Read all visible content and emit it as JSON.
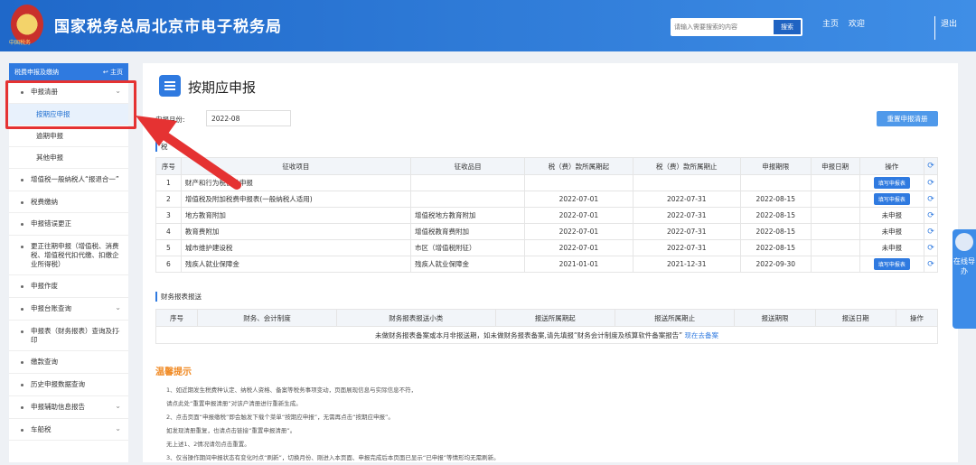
{
  "header": {
    "logo_sub": "中国税务",
    "title": "国家税务总局北京市电子税务局",
    "search_placeholder": "请输入需要搜索的内容",
    "search_button": "搜索",
    "home": "主页",
    "welcome": "欢迎",
    "logout": "退出"
  },
  "sidebar": {
    "top_label": "税费申报及缴纳",
    "top_home": "主页",
    "group_label": "申报清册",
    "sub_items": [
      "按期应申报",
      "逾期申报",
      "其他申报"
    ],
    "items": [
      "增值税一般纳税人“报退合一”",
      "税费缴纳",
      "申报错误更正",
      "更正往期申报（增值税、消费税、增值税代扣代缴、扣缴企业所得税）",
      "申报作废",
      "申报台账查询",
      "申报表（财务报表）查询及打印",
      "缴款查询",
      "历史申报数据查询",
      "申报辅助信息报告",
      "车船税"
    ]
  },
  "main": {
    "page_title": "按期应申报",
    "month_label": "申报月份:",
    "month_value": "2022-08",
    "reset_button": "重置申报清册",
    "section1": "税",
    "table1_headers": [
      "序号",
      "征收项目",
      "征收品目",
      "税（费）款所属期起",
      "税（费）款所属期止",
      "申报期限",
      "申报日期",
      "操作"
    ],
    "table1_rows": [
      {
        "no": "1",
        "item": "财产和行为税合并申报",
        "sub": "",
        "start": "",
        "end": "",
        "deadline": "",
        "date": "",
        "op": "填写申报表",
        "op_button": true
      },
      {
        "no": "2",
        "item": "增值税及附加税费申报表(一般纳税人适用)",
        "sub": "",
        "start": "2022-07-01",
        "end": "2022-07-31",
        "deadline": "2022-08-15",
        "date": "",
        "op": "填写申报表",
        "op_button": true
      },
      {
        "no": "3",
        "item": "地方教育附加",
        "sub": "增值税地方教育附加",
        "start": "2022-07-01",
        "end": "2022-07-31",
        "deadline": "2022-08-15",
        "date": "",
        "op": "未申报",
        "op_button": false
      },
      {
        "no": "4",
        "item": "教育费附加",
        "sub": "增值税教育费附加",
        "start": "2022-07-01",
        "end": "2022-07-31",
        "deadline": "2022-08-15",
        "date": "",
        "op": "未申报",
        "op_button": false
      },
      {
        "no": "5",
        "item": "城市维护建设税",
        "sub": "市区（增值税附征）",
        "start": "2022-07-01",
        "end": "2022-07-31",
        "deadline": "2022-08-15",
        "date": "",
        "op": "未申报",
        "op_button": false
      },
      {
        "no": "6",
        "item": "残疾人就业保障金",
        "sub": "残疾人就业保障金",
        "start": "2021-01-01",
        "end": "2021-12-31",
        "deadline": "2022-09-30",
        "date": "",
        "op": "填写申报表",
        "op_button": true
      }
    ],
    "section2": "财务报表报送",
    "table2_headers": [
      "序号",
      "财务、会计制度",
      "财务报表报送小类",
      "报送所属期起",
      "报送所属期止",
      "报送期限",
      "报送日期",
      "操作"
    ],
    "table2_notice": "未做财务报表备案或本月非报送期，如未做财务报表备案,请先填报“财务会计制度及核算软件备案报告”",
    "table2_link": "现在去备案",
    "tips_title": "温馨提示",
    "tips": [
      "1、如近期发生税费种认定、纳税人资格、备案等税务事项变动，页面展现信息与实际信息不符，",
      "请点此处“重置申报清册”对该户清册进行重新生成。",
      "2、点击页面“申报缴税”即会触发下载个菜单“按期应申报”，无需再点击“按期应申报”。",
      "如发现清册重复，也请点击链接“重置申报清册”。",
      "无上述1、2情况请勿点击重置。",
      "3、仅当操作期间申报状态有变化时点“刷新”，切换月份、刚进入本页面、申报完成后本页面已显示“已申报”等情形均无需刷新。"
    ]
  },
  "float_help": {
    "text": "在线导办"
  }
}
